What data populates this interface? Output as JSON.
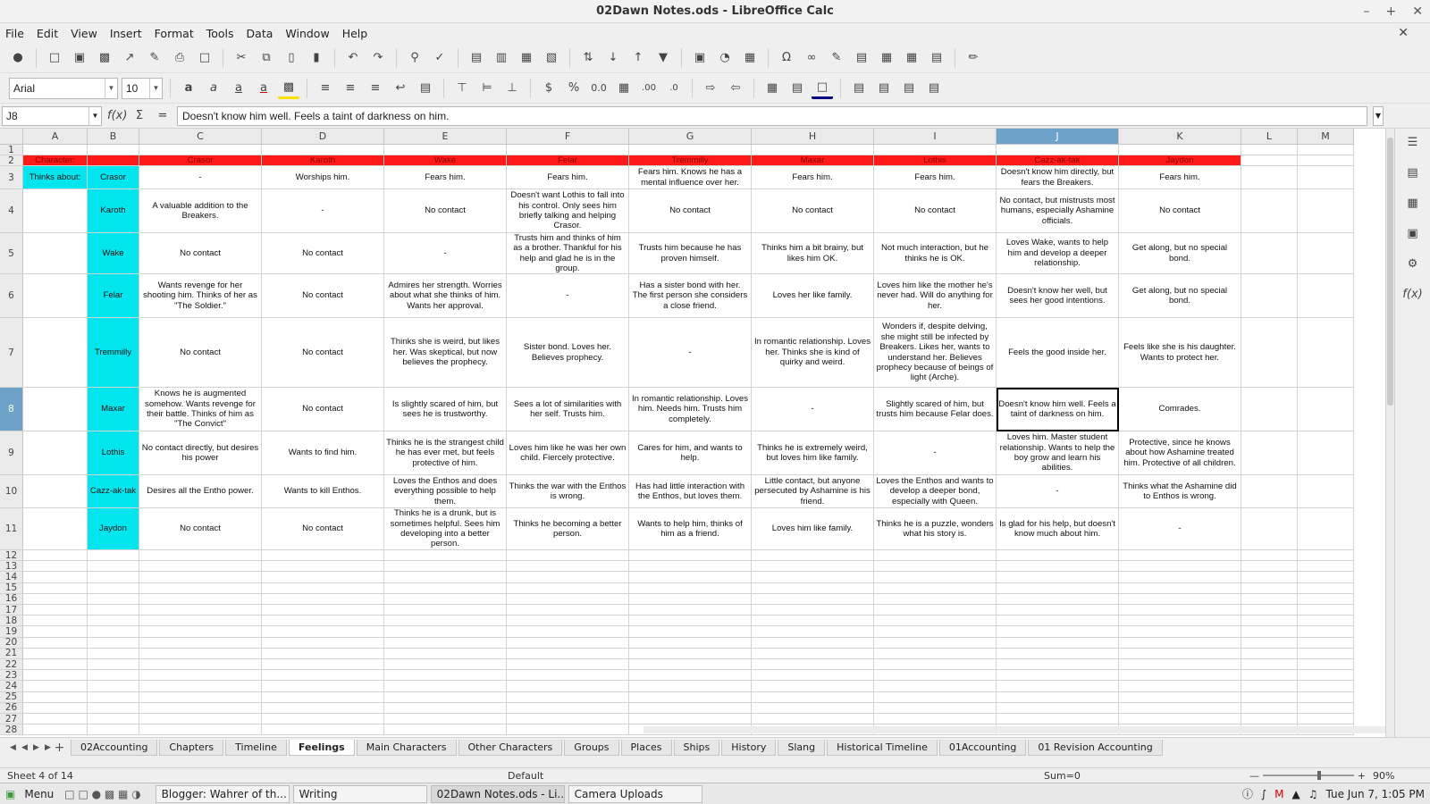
{
  "window": {
    "title": "02Dawn Notes.ods - LibreOffice Calc",
    "minimize": "–",
    "maximize": "+",
    "close": "✕"
  },
  "menu": [
    "File",
    "Edit",
    "View",
    "Insert",
    "Format",
    "Tools",
    "Data",
    "Window",
    "Help"
  ],
  "menu_close": "✕",
  "font": {
    "name": "Arial",
    "size": "10"
  },
  "formula": {
    "cell_ref": "J8",
    "fx": "f(x)",
    "sigma": "Σ",
    "equals": "=",
    "content": "Doesn't know him well. Feels a taint of darkness on him."
  },
  "columns": [
    "A",
    "B",
    "C",
    "D",
    "E",
    "F",
    "G",
    "H",
    "I",
    "J",
    "K",
    "L",
    "M"
  ],
  "rows": [
    "1",
    "2",
    "3",
    "4",
    "5",
    "6",
    "7",
    "8",
    "9",
    "10",
    "11",
    "12",
    "13",
    "14",
    "15",
    "16",
    "17",
    "18",
    "19",
    "20",
    "21",
    "22",
    "23",
    "24",
    "25",
    "26",
    "27",
    "28"
  ],
  "sheet": {
    "header_row": [
      "Character:",
      "",
      "Crasor",
      "Karoth",
      "Wake",
      "Felar",
      "Tremmilly",
      "Maxar",
      "Lothis",
      "Cazz-ak-tak",
      "Jaydon"
    ],
    "thinks_about": "Thinks about:",
    "body": [
      [
        "Crasor",
        "-",
        "Worships him.",
        "Fears him.",
        "Fears him.",
        "Fears him. Knows he has a mental influence over her.",
        "Fears him.",
        "Fears him.",
        "Doesn't know him directly, but fears the Breakers.",
        "Fears him."
      ],
      [
        "Karoth",
        "A valuable addition to the Breakers.",
        "-",
        "No contact",
        "Doesn't want Lothis to fall into his control. Only sees him briefly talking and helping Crasor.",
        "No contact",
        "No contact",
        "No contact",
        "No contact, but mistrusts most humans, especially Ashamine officials.",
        "No contact"
      ],
      [
        "Wake",
        "No contact",
        "No contact",
        "-",
        "Trusts him and thinks of him as a brother. Thankful for his help and glad he is in the group.",
        "Trusts him because he has proven himself.",
        "Thinks him a bit brainy, but likes him OK.",
        "Not much interaction, but he thinks he is OK.",
        "Loves Wake, wants to help him and develop a deeper relationship.",
        "Get along, but no special bond."
      ],
      [
        "Felar",
        "Wants revenge for her shooting him. Thinks of her as \"The Soldier.\"",
        "No contact",
        "Admires her strength. Worries about what she thinks of him. Wants her approval.",
        "-",
        "Has a sister bond with her. The first person she considers a close friend.",
        "Loves her like family.",
        "Loves him like the mother he's never had. Will do anything for her.",
        "Doesn't know her well, but sees her good intentions.",
        "Get along, but no special bond."
      ],
      [
        "Tremmilly",
        "No contact",
        "No contact",
        "Thinks she is weird, but likes her. Was skeptical, but now believes the prophecy.",
        "Sister bond. Loves her. Believes prophecy.",
        "-",
        "In romantic relationship. Loves her. Thinks she is kind of quirky and weird.",
        "Wonders if, despite delving, she might still be infected by Breakers. Likes her, wants to understand her. Believes prophecy because of beings of light (Arche).",
        "Feels the good inside her.",
        "Feels like she is his daughter. Wants to protect her."
      ],
      [
        "Maxar",
        "Knows he is augmented somehow. Wants revenge for their battle. Thinks of him as \"The Convict\"",
        "No contact",
        "Is slightly scared of him, but sees he is trustworthy.",
        "Sees a lot of similarities with her self. Trusts him.",
        "In romantic relationship. Loves him. Needs him. Trusts him completely.",
        "-",
        "Slightly scared of him, but trusts him because Felar does.",
        "Doesn't know him well. Feels a taint of darkness on him.",
        "Comrades."
      ],
      [
        "Lothis",
        "No contact directly, but desires his power",
        "Wants to find him.",
        "Thinks he is the strangest child he has ever met, but feels protective of him.",
        "Loves him like he was her own child. Fiercely protective.",
        "Cares for him, and wants to help.",
        "Thinks he is extremely weird, but loves him like family.",
        "-",
        "Loves him. Master student relationship. Wants to help the boy grow and learn his abilities.",
        "Protective, since he knows about how Ashamine treated him. Protective of all children."
      ],
      [
        "Cazz-ak-tak",
        "Desires all the Entho power.",
        "Wants to kill Enthos.",
        "Loves the Enthos and does everything possible to help them.",
        "Thinks the war with the Enthos is wrong.",
        "Has had little interaction with the Enthos, but loves them.",
        "Little contact, but anyone persecuted by Ashamine is his friend.",
        "Loves the Enthos and wants to develop a deeper bond, especially with Queen.",
        "-",
        "Thinks what the Ashamine did to Enthos is wrong."
      ],
      [
        "Jaydon",
        "No contact",
        "No contact",
        "Thinks he is a drunk, but is sometimes helpful. Sees him developing into a better person.",
        "Thinks he becoming a better person.",
        "Wants to help him, thinks of him as a friend.",
        "Loves him like family.",
        "Thinks he is a puzzle, wonders what his story is.",
        "Is glad for his help, but doesn't know much about him.",
        "-"
      ]
    ]
  },
  "tabs": [
    "02Accounting",
    "Chapters",
    "Timeline",
    "Feelings",
    "Main Characters",
    "Other Characters",
    "Groups",
    "Places",
    "Ships",
    "History",
    "Slang",
    "Historical Timeline",
    "01Accounting",
    "01 Revision Accounting"
  ],
  "active_tab": "Feelings",
  "status": {
    "sheet": "Sheet 4 of 14",
    "style": "Default",
    "sum": "Sum=0",
    "zoom": "90%"
  },
  "taskbar": {
    "menu": "Menu",
    "tasks": [
      "Blogger: Wahrer of th...",
      "Writing",
      "02Dawn Notes.ods - Li...",
      "Camera Uploads"
    ],
    "clock": "Tue Jun 7, 1:05 PM"
  },
  "colors": {
    "header_red": "#ff1a1a",
    "name_cyan": "#00e5ee",
    "selection_blue": "#6da3c9"
  }
}
